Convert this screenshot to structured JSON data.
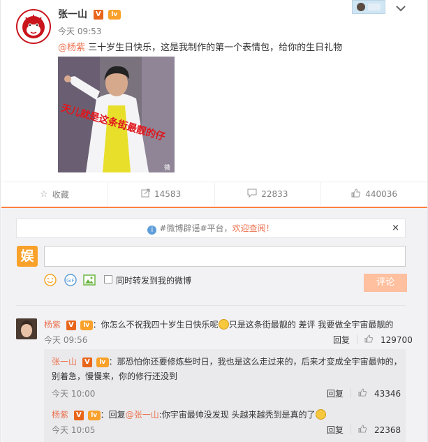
{
  "post": {
    "author": "张一山",
    "v_badge": "V",
    "level_badge": "lv",
    "time": "今天 09:53",
    "mention": "@杨紫",
    "text": " 三十岁生日快乐，这是我制作的第一个表情包，给你的生日礼物",
    "image_caption": "天儿就是这条街最靓的仔",
    "image_watermark": "微"
  },
  "actions": [
    {
      "icon": "star-icon",
      "label": "收藏"
    },
    {
      "icon": "share-icon",
      "label": "14583"
    },
    {
      "icon": "comment-icon",
      "label": "22833"
    },
    {
      "icon": "like-icon",
      "label": "440036"
    }
  ],
  "notice": {
    "tag1": "#微博辟谣#",
    "tag2": "平台，",
    "highlight": "欢迎查阅！",
    "close": "×"
  },
  "compose": {
    "avatar_text": "娱",
    "forward_label": "同时转发到我的微博",
    "submit_label": "评论"
  },
  "comment": {
    "name": "杨紫",
    "text1": "：你怎么不祝我四十岁生日快乐呢",
    "text2": "只是这条街最靓的 差评 我要做全宇宙最靓的",
    "time": "今天 09:56",
    "reply_label": "回复",
    "likes": "129700"
  },
  "replies": [
    {
      "name": "张一山",
      "line1": "：那恐怕你还要修炼些时日，我也是这么走过来的，后来才变成全宇宙最帅的，",
      "line2": "别着急，慢慢来，你的修行还没到",
      "time": "今天 10:00",
      "reply_label": "回复",
      "likes": "43346"
    },
    {
      "name": "杨紫",
      "prefix": "：回复",
      "mention": "@张一山",
      "line1": ":你宇宙最帅没发现 头越来越秃到是真的了",
      "time": "今天 10:05",
      "reply_label": "回复",
      "likes": "22368"
    }
  ]
}
